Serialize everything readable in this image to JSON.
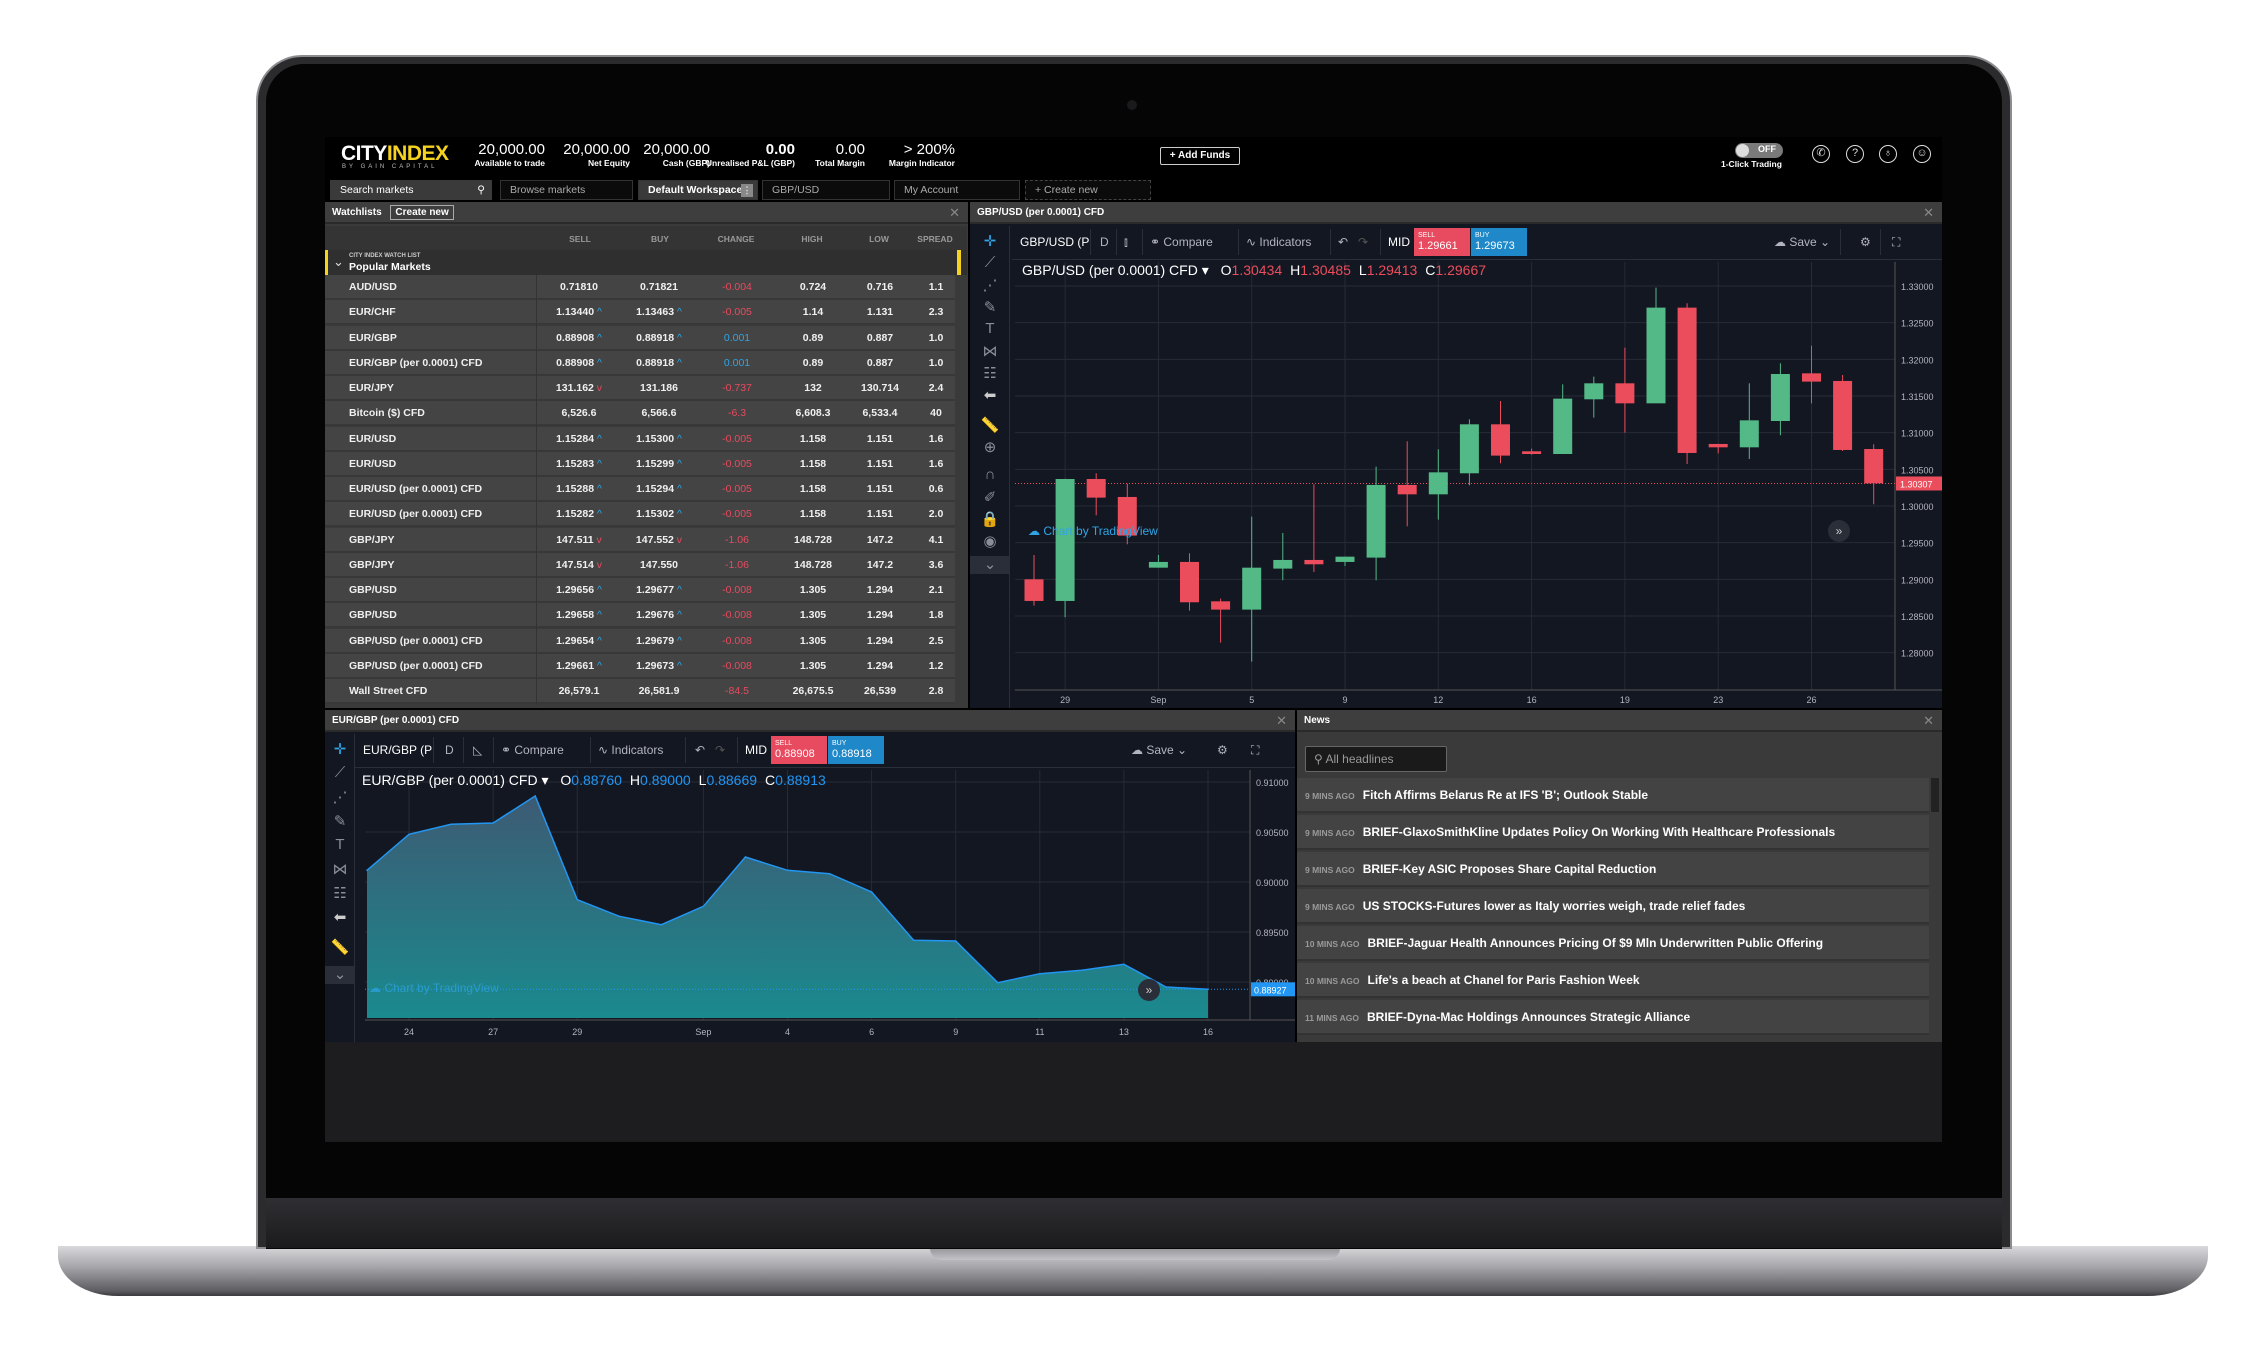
{
  "header": {
    "logo_main": "CITY",
    "logo_accent": "INDEX",
    "logo_sub": "BY GAIN CAPITAL",
    "stats": [
      {
        "value": "20,000.00",
        "label": "Available to trade"
      },
      {
        "value": "20,000.00",
        "label": "Net Equity"
      },
      {
        "value": "20,000.00",
        "label": "Cash (GBP)"
      },
      {
        "value": "0.00",
        "label": "Unrealised P&L (GBP)"
      },
      {
        "value": "0.00",
        "label": "Total Margin"
      },
      {
        "value": "> 200%",
        "label": "Margin Indicator"
      }
    ],
    "add_funds": "+ Add Funds",
    "toggle_state": "OFF",
    "toggle_label": "1-Click Trading",
    "icons": [
      "phone-icon",
      "help-icon",
      "bell-icon",
      "user-icon"
    ]
  },
  "tabs": {
    "search_placeholder": "Search markets",
    "items": [
      "Browse markets",
      "Default Workspace",
      "GBP/USD",
      "My Account",
      "+ Create new"
    ],
    "active": "Default Workspace"
  },
  "watchlist": {
    "title": "Watchlists",
    "create_new": "Create new",
    "columns": [
      "SELL",
      "BUY",
      "CHANGE",
      "HIGH",
      "LOW",
      "SPREAD"
    ],
    "group_caption": "CITY INDEX WATCH LIST",
    "group_name": "Popular Markets",
    "accent": "#f4d21f",
    "rows": [
      {
        "name": "AUD/USD",
        "sell": "0.71810",
        "sell_dir": "",
        "buy": "0.71821",
        "buy_dir": "",
        "change": "-0.004",
        "high": "0.724",
        "low": "0.716",
        "spread": "1.1"
      },
      {
        "name": "EUR/CHF",
        "sell": "1.13440",
        "sell_dir": "up",
        "buy": "1.13463",
        "buy_dir": "up",
        "change": "-0.005",
        "high": "1.14",
        "low": "1.131",
        "spread": "2.3"
      },
      {
        "name": "EUR/GBP",
        "sell": "0.88908",
        "sell_dir": "up",
        "buy": "0.88918",
        "buy_dir": "up",
        "change": "0.001",
        "high": "0.89",
        "low": "0.887",
        "spread": "1.0"
      },
      {
        "name": "EUR/GBP (per 0.0001) CFD",
        "sell": "0.88908",
        "sell_dir": "up",
        "buy": "0.88918",
        "buy_dir": "up",
        "change": "0.001",
        "high": "0.89",
        "low": "0.887",
        "spread": "1.0"
      },
      {
        "name": "EUR/JPY",
        "sell": "131.162",
        "sell_dir": "down",
        "buy": "131.186",
        "buy_dir": "",
        "change": "-0.737",
        "high": "132",
        "low": "130.714",
        "spread": "2.4"
      },
      {
        "name": "Bitcoin ($) CFD",
        "sell": "6,526.6",
        "sell_dir": "",
        "buy": "6,566.6",
        "buy_dir": "",
        "change": "-6.3",
        "high": "6,608.3",
        "low": "6,533.4",
        "spread": "40"
      },
      {
        "name": "EUR/USD",
        "sell": "1.15284",
        "sell_dir": "up",
        "buy": "1.15300",
        "buy_dir": "up",
        "change": "-0.005",
        "high": "1.158",
        "low": "1.151",
        "spread": "1.6"
      },
      {
        "name": "EUR/USD",
        "sell": "1.15283",
        "sell_dir": "up",
        "buy": "1.15299",
        "buy_dir": "up",
        "change": "-0.005",
        "high": "1.158",
        "low": "1.151",
        "spread": "1.6"
      },
      {
        "name": "EUR/USD (per 0.0001) CFD",
        "sell": "1.15288",
        "sell_dir": "up",
        "buy": "1.15294",
        "buy_dir": "up",
        "change": "-0.005",
        "high": "1.158",
        "low": "1.151",
        "spread": "0.6"
      },
      {
        "name": "EUR/USD (per 0.0001) CFD",
        "sell": "1.15282",
        "sell_dir": "up",
        "buy": "1.15302",
        "buy_dir": "up",
        "change": "-0.005",
        "high": "1.158",
        "low": "1.151",
        "spread": "2.0"
      },
      {
        "name": "GBP/JPY",
        "sell": "147.511",
        "sell_dir": "down",
        "buy": "147.552",
        "buy_dir": "down",
        "change": "-1.06",
        "high": "148.728",
        "low": "147.2",
        "spread": "4.1"
      },
      {
        "name": "GBP/JPY",
        "sell": "147.514",
        "sell_dir": "down",
        "buy": "147.550",
        "buy_dir": "",
        "change": "-1.06",
        "high": "148.728",
        "low": "147.2",
        "spread": "3.6"
      },
      {
        "name": "GBP/USD",
        "sell": "1.29656",
        "sell_dir": "up",
        "buy": "1.29677",
        "buy_dir": "up",
        "change": "-0.008",
        "high": "1.305",
        "low": "1.294",
        "spread": "2.1"
      },
      {
        "name": "GBP/USD",
        "sell": "1.29658",
        "sell_dir": "up",
        "buy": "1.29676",
        "buy_dir": "up",
        "change": "-0.008",
        "high": "1.305",
        "low": "1.294",
        "spread": "1.8"
      },
      {
        "name": "GBP/USD (per 0.0001) CFD",
        "sell": "1.29654",
        "sell_dir": "up",
        "buy": "1.29679",
        "buy_dir": "up",
        "change": "-0.008",
        "high": "1.305",
        "low": "1.294",
        "spread": "2.5"
      },
      {
        "name": "GBP/USD (per 0.0001) CFD",
        "sell": "1.29661",
        "sell_dir": "up",
        "buy": "1.29673",
        "buy_dir": "up",
        "change": "-0.008",
        "high": "1.305",
        "low": "1.294",
        "spread": "1.2"
      },
      {
        "name": "Wall Street CFD",
        "sell": "26,579.1",
        "sell_dir": "",
        "buy": "26,581.9",
        "buy_dir": "",
        "change": "-84.5",
        "high": "26,675.5",
        "low": "26,539",
        "spread": "2.8"
      }
    ]
  },
  "chart_top": {
    "panel_title": "GBP/USD (per 0.0001) CFD",
    "symbol_short": "GBP/USD (P",
    "interval": "D",
    "compare": "Compare",
    "indicators": "Indicators",
    "mid": "MID",
    "sell_label": "SELL",
    "sell_price": "1.29661",
    "buy_label": "BUY",
    "buy_price": "1.29673",
    "save": "Save",
    "legend_symbol": "GBP/USD (per 0.0001) CFD",
    "o": "1.30434",
    "h": "1.30485",
    "l": "1.29413",
    "c": "1.29667",
    "watermark": "Chart by TradingView"
  },
  "chart_bottom": {
    "panel_title": "EUR/GBP (per 0.0001) CFD",
    "symbol_short": "EUR/GBP (P",
    "interval": "D",
    "compare": "Compare",
    "indicators": "Indicators",
    "mid": "MID",
    "sell_label": "SELL",
    "sell_price": "0.88908",
    "buy_label": "BUY",
    "buy_price": "0.88918",
    "save": "Save",
    "legend_symbol": "EUR/GBP (per 0.0001) CFD",
    "o": "0.88760",
    "h": "0.89000",
    "l": "0.88669",
    "c": "0.88913",
    "watermark": "Chart by TradingView"
  },
  "chart_data": [
    {
      "type": "candlestick",
      "up_color": "#53b987",
      "down_color": "#eb4d5c",
      "ylim": [
        1.2775,
        1.3325
      ],
      "y_ticks": [
        "1.33000",
        "1.32500",
        "1.32000",
        "1.31500",
        "1.31000",
        "1.30500",
        "1.30000",
        "1.29500",
        "1.29000",
        "1.28500",
        "1.28000"
      ],
      "last_price": "1.30307",
      "x_tick_labels": [
        {
          "i": 1,
          "label": "29"
        },
        {
          "i": 4,
          "label": "Sep"
        },
        {
          "i": 7,
          "label": "5"
        },
        {
          "i": 10,
          "label": "9"
        },
        {
          "i": 13,
          "label": "12"
        },
        {
          "i": 16,
          "label": "16"
        },
        {
          "i": 19,
          "label": "19"
        },
        {
          "i": 22,
          "label": "23"
        },
        {
          "i": 25,
          "label": "26"
        }
      ],
      "ohlc": [
        [
          1.29,
          1.29332,
          1.28641,
          1.28705
        ],
        [
          1.28705,
          1.3037,
          1.28482,
          1.30368
        ],
        [
          1.30368,
          1.30446,
          1.29873,
          1.30114
        ],
        [
          1.30123,
          1.30305,
          1.29478,
          1.29596
        ],
        [
          1.29159,
          1.29332,
          1.29159,
          1.29237
        ],
        [
          1.29237,
          1.29355,
          1.28573,
          1.28687
        ],
        [
          1.287,
          1.28737,
          1.28137,
          1.28587
        ],
        [
          1.28587,
          1.29855,
          1.27878,
          1.29159
        ],
        [
          1.29146,
          1.29632,
          1.28987,
          1.29264
        ],
        [
          1.29264,
          1.30296,
          1.291,
          1.29205
        ],
        [
          1.29237,
          1.29309,
          1.29182,
          1.29309
        ],
        [
          1.29296,
          1.30537,
          1.28987,
          1.30287
        ],
        [
          1.30287,
          1.30882,
          1.29723,
          1.30159
        ],
        [
          1.30159,
          1.30773,
          1.29814,
          1.30459
        ],
        [
          1.30446,
          1.31182,
          1.30282,
          1.31114
        ],
        [
          1.31114,
          1.31432,
          1.30582,
          1.30687
        ],
        [
          1.30746,
          1.30782,
          1.307,
          1.30709
        ],
        [
          1.30709,
          1.31659,
          1.30709,
          1.31464
        ],
        [
          1.31455,
          1.31764,
          1.31205,
          1.31673
        ],
        [
          1.31673,
          1.32159,
          1.31,
          1.314
        ],
        [
          1.314,
          1.32977,
          1.314,
          1.32705
        ],
        [
          1.32705,
          1.32764,
          1.30573,
          1.30723
        ],
        [
          1.30846,
          1.30846,
          1.30718,
          1.308
        ],
        [
          1.308,
          1.31673,
          1.30641,
          1.31168
        ],
        [
          1.31159,
          1.31946,
          1.30964,
          1.318
        ],
        [
          1.31809,
          1.32186,
          1.314,
          1.31696
        ],
        [
          1.31705,
          1.31786,
          1.3075,
          1.30764
        ],
        [
          1.30777,
          1.30841,
          1.30023,
          1.30309
        ]
      ]
    },
    {
      "type": "area",
      "color": "#2196f3",
      "fill": "#1a8a8e",
      "ylim": [
        0.887,
        0.911
      ],
      "y_ticks": [
        "0.91000",
        "0.90500",
        "0.90000",
        "0.89500",
        "0.89000"
      ],
      "last_price": "0.88927",
      "x_tick_labels": [
        {
          "i": 1,
          "label": "24"
        },
        {
          "i": 3,
          "label": "27"
        },
        {
          "i": 5,
          "label": "29"
        },
        {
          "i": 8,
          "label": "Sep"
        },
        {
          "i": 10,
          "label": "4"
        },
        {
          "i": 12,
          "label": "6"
        },
        {
          "i": 14,
          "label": "9"
        },
        {
          "i": 16,
          "label": "11"
        },
        {
          "i": 18,
          "label": "13"
        },
        {
          "i": 20,
          "label": "16"
        }
      ],
      "values": [
        0.90117,
        0.90477,
        0.90577,
        0.9059,
        0.9086,
        0.89823,
        0.89657,
        0.89573,
        0.89757,
        0.9025,
        0.90117,
        0.90083,
        0.899,
        0.89417,
        0.8941,
        0.88993,
        0.89083,
        0.89117,
        0.89177,
        0.8895,
        0.88927
      ]
    }
  ],
  "news": {
    "title": "News",
    "search_placeholder": "All headlines",
    "items": [
      {
        "ago": "9 MINS AGO",
        "headline": "Fitch Affirms Belarus Re at IFS 'B'; Outlook Stable"
      },
      {
        "ago": "9 MINS AGO",
        "headline": "BRIEF-GlaxoSmithKline Updates Policy On Working With Healthcare Professionals"
      },
      {
        "ago": "9 MINS AGO",
        "headline": "BRIEF-Key ASIC Proposes Share Capital Reduction"
      },
      {
        "ago": "9 MINS AGO",
        "headline": "US STOCKS-Futures lower as Italy worries weigh, trade relief fades"
      },
      {
        "ago": "10 MINS AGO",
        "headline": "BRIEF-Jaguar Health Announces Pricing Of $9 Mln Underwritten Public Offering"
      },
      {
        "ago": "10 MINS AGO",
        "headline": "Life's a beach at Chanel for Paris Fashion Week"
      },
      {
        "ago": "11 MINS AGO",
        "headline": "BRIEF-Dyna-Mac Holdings Announces Strategic Alliance"
      }
    ]
  }
}
